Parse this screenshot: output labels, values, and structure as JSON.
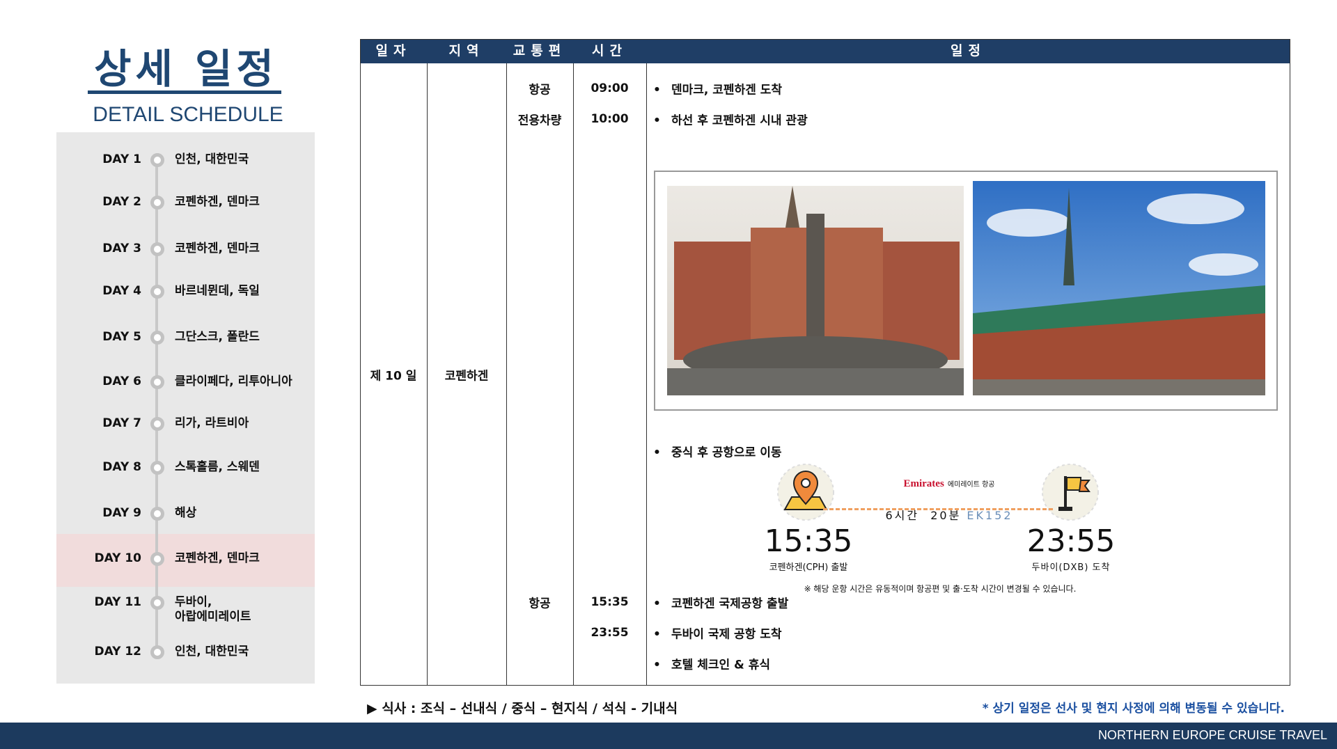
{
  "header": {
    "title": "상세 일정",
    "subtitle": "DETAIL SCHEDULE"
  },
  "sidebar": {
    "days": [
      {
        "day": "DAY 1",
        "place": "인천, 대한민국"
      },
      {
        "day": "DAY 2",
        "place": "코펜하겐, 덴마크"
      },
      {
        "day": "DAY 3",
        "place": "코펜하겐, 덴마크"
      },
      {
        "day": "DAY 4",
        "place": "바르네뮌데, 독일"
      },
      {
        "day": "DAY 5",
        "place": "그단스크, 폴란드"
      },
      {
        "day": "DAY 6",
        "place": "클라이페다, 리투아니아"
      },
      {
        "day": "DAY 7",
        "place": "리가, 라트비아"
      },
      {
        "day": "DAY 8",
        "place": "스톡홀름, 스웨덴"
      },
      {
        "day": "DAY 9",
        "place": "해상"
      },
      {
        "day": "DAY 10",
        "place": "코펜하겐, 덴마크"
      },
      {
        "day": "DAY 11",
        "place": "두바이,",
        "place2": "아랍에미레이트"
      },
      {
        "day": "DAY 12",
        "place": "인천, 대한민국"
      }
    ],
    "active": "DAY 10",
    "highlight_color": "#f1dcdc"
  },
  "table": {
    "headers": [
      "일자",
      "지역",
      "교통편",
      "시간",
      "일정"
    ],
    "day": "제 10 일",
    "region": "코펜하겐",
    "rows": [
      {
        "transport": "항공",
        "time": "09:00",
        "text": "덴마크, 코펜하겐 도착"
      },
      {
        "transport": "전용차량",
        "time": "10:00",
        "text": "하선 후 코펜하겐 시내 관광"
      },
      {
        "text": "중식 후 공항으로 이동"
      },
      {
        "transport": "항공",
        "time": "15:35",
        "text": "코펜하겐 국제공항 출발"
      },
      {
        "time": "23:55",
        "text": "두바이 국제 공항 도착"
      },
      {
        "text": "호텔 체크인 & 휴식"
      }
    ]
  },
  "flight": {
    "airline_logo": "Emirates",
    "airline_kr": "에미레이트 항공",
    "duration": "6시간  20분",
    "flight_no": "EK152",
    "dep_time": "15:35",
    "dep_label": "코펜하겐(CPH) 출발",
    "arr_time": "23:55",
    "arr_label": "두바이(DXB) 도착",
    "note": "※ 해당 운항 시간은 유동적이며 항공편 및 출·도착 시간이 변경될 수 있습니다."
  },
  "footer": {
    "meals": "▶ 식사 : 조식 – 선내식 / 중식 – 현지식 / 석식 - 기내식",
    "notice": "* 상기 일정은 선사 및 현지 사정에 의해 변동될 수 있습니다.",
    "brand": "NORTHERN EUROPE CRUISE TRAVEL"
  },
  "colors": {
    "navy": "#1f3e66",
    "accent_blue": "#1a4fa0",
    "orange": "#f08a3c"
  }
}
